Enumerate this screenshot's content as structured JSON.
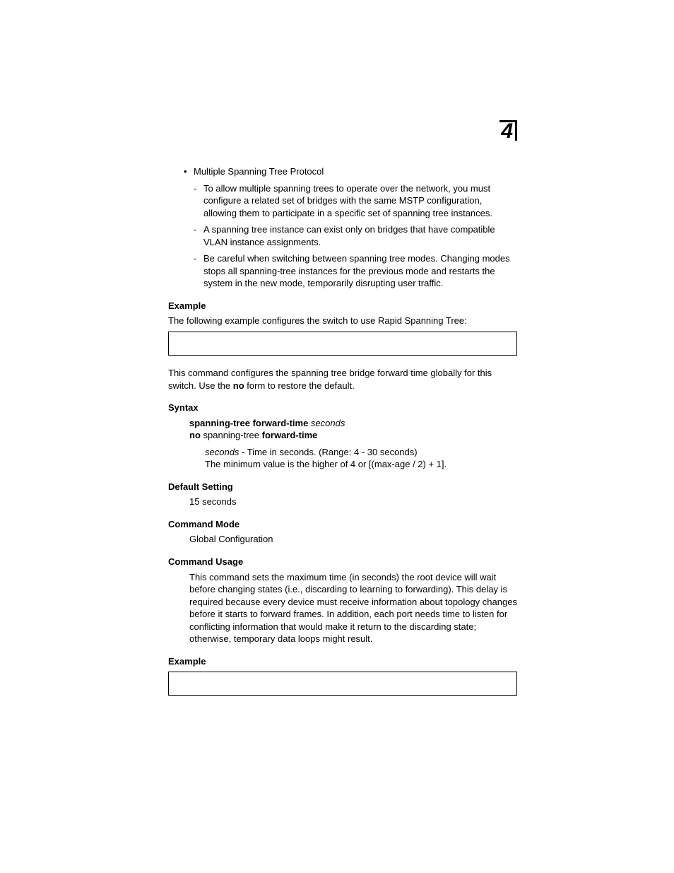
{
  "chapter": "4",
  "bullet": "•",
  "bullet_text": "Multiple Spanning Tree Protocol",
  "dash": "-",
  "sub_items": [
    "To allow multiple spanning trees to operate over the network, you must configure a related set of bridges with the same MSTP configuration, allowing them to participate in a specific set of spanning tree instances.",
    "A spanning tree instance can exist only on bridges that have compatible VLAN instance assignments.",
    "Be careful when switching between spanning tree modes. Changing modes stops all spanning-tree instances for the previous mode and restarts the system in the new mode, temporarily disrupting user traffic."
  ],
  "example_heading": "Example",
  "example_text": "The following example configures the switch to use Rapid Spanning Tree:",
  "intro_para_1a": "This command configures the spanning tree bridge forward time globally for this switch. Use the ",
  "intro_para_1b_bold": "no",
  "intro_para_1c": " form to restore the default.",
  "syntax_heading": "Syntax",
  "syntax_line1_bold": "spanning-tree forward-time",
  "syntax_line1_italic": " seconds",
  "syntax_line2_bold1": "no",
  "syntax_line2_plain": " spanning-tree ",
  "syntax_line2_bold2": "forward-time",
  "seconds_italic": "seconds",
  "seconds_rest": " - Time in seconds. (Range: 4 - 30 seconds)",
  "seconds_line2": "The minimum value is the higher of 4 or [(max-age / 2) + 1].",
  "default_heading": "Default Setting",
  "default_value": "15 seconds",
  "mode_heading": "Command Mode",
  "mode_value": "Global Configuration",
  "usage_heading": "Command Usage",
  "usage_text": "This command sets the maximum time (in seconds) the root device will wait before changing states (i.e., discarding to learning to forwarding). This delay is required because every device must receive information about topology changes before it starts to forward frames. In addition, each port needs time to listen for conflicting information that would make it return to the discarding state; otherwise, temporary data loops might result.",
  "example2_heading": "Example"
}
